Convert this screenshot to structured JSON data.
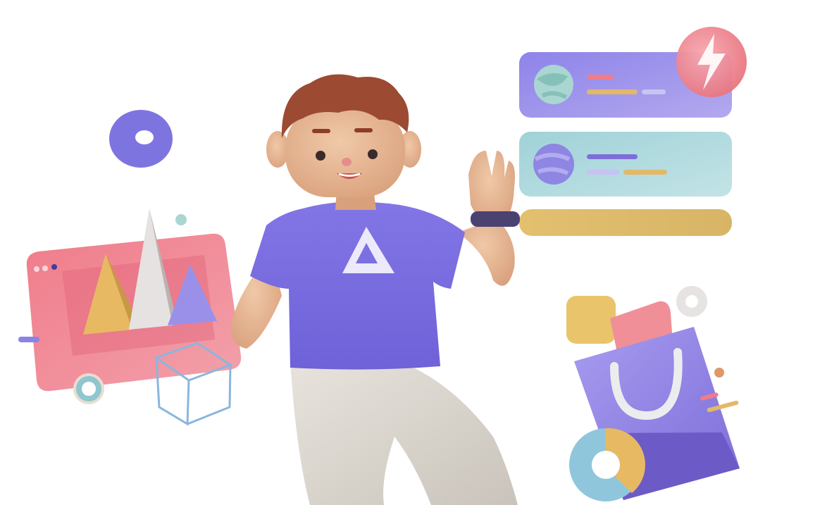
{
  "illustration": {
    "subject": "",
    "shirt_logo_icon": "triangle-logo-icon",
    "colors": {
      "shirt": "#7b6fe0",
      "hair": "#9c4a32",
      "skin": "#e7b896",
      "pants": "#dcd7cf",
      "card_purple": "#8f86e6",
      "card_teal": "#a9d6db",
      "card_yellow": "#ddb96c",
      "chart_panel": "#ec7f8c",
      "bag": "#8c7fe0",
      "lightning_badge": "#f08f98"
    }
  },
  "cards": [
    {
      "name": "profile-card-purple",
      "avatar_icon": "planet-avatar-icon"
    },
    {
      "name": "profile-card-teal",
      "avatar_icon": "planet-avatar-icon"
    },
    {
      "name": "placeholder-bar-yellow"
    }
  ],
  "decor_icons": [
    "donut-icon",
    "ring-icon",
    "wireframe-cube-icon",
    "lightning-badge-icon",
    "shopping-bag-icon",
    "donut-chart-icon",
    "pyramid-chart-icon"
  ]
}
